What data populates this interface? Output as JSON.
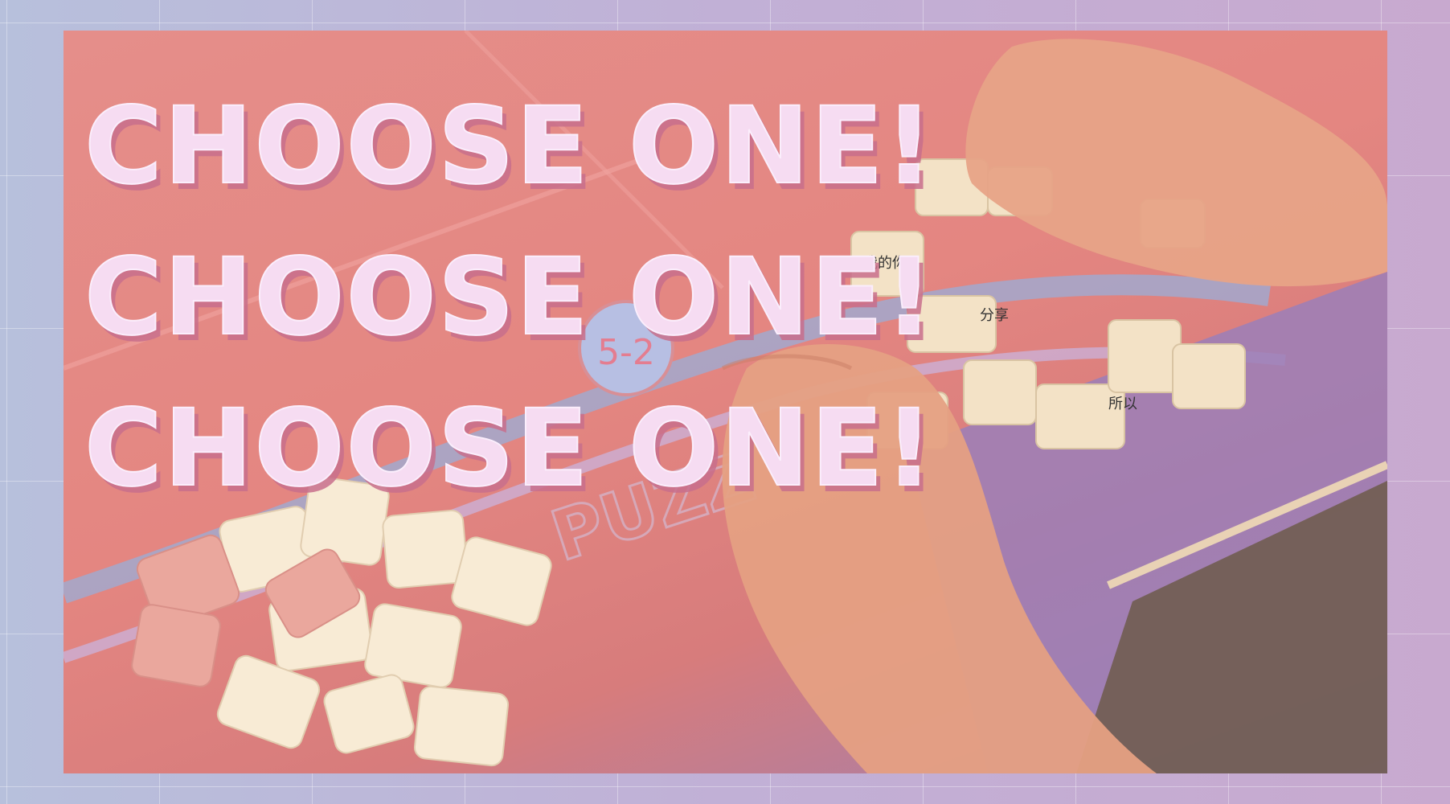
{
  "headline": {
    "lines": [
      "CHOOSE ONE!",
      "CHOOSE ONE!",
      "CHOOSE ONE!"
    ]
  },
  "photo": {
    "badge_text": "5-2",
    "mat_text": "PUZZ",
    "puzzle_texts": [
      "我的你",
      "分享",
      "所以"
    ]
  },
  "colors": {
    "frame_left": "#b7c0dc",
    "frame_right": "#c8a9cf",
    "mat_pink": "#e48681",
    "mat_purple": "#9a7fb4",
    "headline_fill": "#f6dcf2",
    "headline_shadow": "#c86e8c",
    "puzzle_piece": "#f5e6cc"
  }
}
